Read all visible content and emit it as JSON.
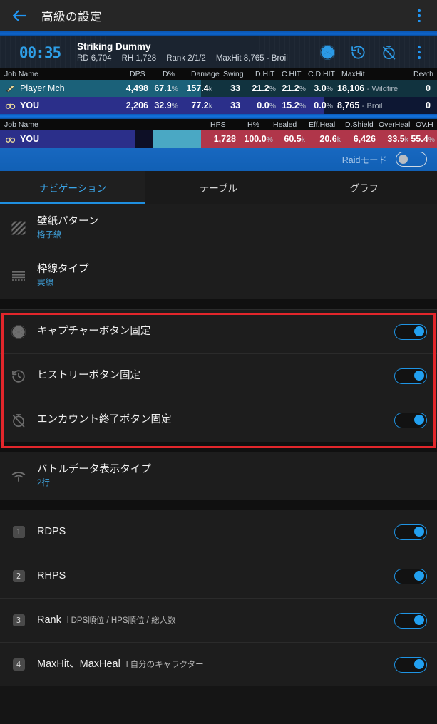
{
  "appbar": {
    "title": "高級の設定",
    "back_icon": "arrow-left-icon",
    "menu_icon": "kebab-menu-icon"
  },
  "meter": {
    "timer": "00:35",
    "encounter_title": "Striking Dummy",
    "stats": [
      {
        "label": "RD",
        "value": "6,704"
      },
      {
        "label": "RH",
        "value": "1,728"
      },
      {
        "label": "Rank",
        "value": "2/1/2"
      },
      {
        "label": "MaxHit",
        "value": "8,765 - Broil"
      }
    ],
    "stats_inline": [
      "RD 6,704",
      "RH 1,728",
      "Rank 2/1/2",
      "MaxHit 8,765 - Broil"
    ],
    "icons": [
      "capture-aperture-icon",
      "history-clock-icon",
      "end-encounter-icon",
      "kebab-menu-icon"
    ],
    "dps_headers": [
      "Job Name",
      "DPS",
      "D%",
      "Damage",
      "Swing",
      "D.HIT",
      "C.HIT",
      "C.D.HIT",
      "MaxHit",
      "Death"
    ],
    "dps_rows": [
      {
        "job_icon": "machinist-job-icon",
        "name": "Player Mch",
        "dps": "4,498",
        "dpct": "67.1",
        "damage": "157.4",
        "damage_unit": "k",
        "swing": "33",
        "dhit": "21.2",
        "chit": "21.2",
        "cdhit": "3.0",
        "maxhit": "18,106",
        "maxhit_src": "- Wildfire",
        "death": "0",
        "bar_pct": 46
      },
      {
        "job_icon": "astrologian-job-icon",
        "name": "YOU",
        "dps": "2,206",
        "dpct": "32.9",
        "damage": "77.2",
        "damage_unit": "k",
        "swing": "33",
        "dhit": "0.0",
        "chit": "15.2",
        "cdhit": "0.0",
        "maxhit": "8,765",
        "maxhit_src": "- Broil",
        "death": "0",
        "bar_pct": 74
      }
    ],
    "hps_headers": [
      "Job Name",
      "HPS",
      "H%",
      "Healed",
      "Eff.Heal",
      "D.Shield",
      "OverHeal",
      "OV.H"
    ],
    "hps_rows": [
      {
        "job_icon": "astrologian-job-icon",
        "name": "YOU",
        "hps": "1,728",
        "hpct": "100.0",
        "healed": "60.5",
        "healed_unit": "k",
        "effheal": "20.6",
        "effheal_unit": "k",
        "dshield": "6,426",
        "overheal": "33.5",
        "overheal_unit": "k",
        "ovh": "55.4",
        "bar_pct": 31,
        "bar2_pct": 26
      }
    ],
    "raid_mode_label": "Raidモード",
    "raid_mode_on": false
  },
  "tabs": [
    {
      "label": "ナビゲーション",
      "active": true
    },
    {
      "label": "テーブル",
      "active": false
    },
    {
      "label": "グラフ",
      "active": false
    }
  ],
  "settings": {
    "group1": [
      {
        "icon": "diagonal-stripes-icon",
        "title": "壁紙パターン",
        "subtitle": "格子縞",
        "type": "value"
      },
      {
        "icon": "border-lines-icon",
        "title": "枠線タイプ",
        "subtitle": "実線",
        "type": "value"
      }
    ],
    "group_highlighted": [
      {
        "icon": "capture-aperture-icon",
        "title": "キャプチャーボタン固定",
        "type": "toggle",
        "on": true
      },
      {
        "icon": "history-clock-icon",
        "title": "ヒストリーボタン固定",
        "type": "toggle",
        "on": true
      },
      {
        "icon": "end-encounter-icon",
        "title": "エンカウント終了ボタン固定",
        "type": "toggle",
        "on": true
      }
    ],
    "group2": [
      {
        "icon": "signal-rows-icon",
        "title": "バトルデータ表示タイプ",
        "subtitle": "2行",
        "type": "value"
      }
    ],
    "group3": [
      {
        "badge": "1",
        "title": "RDPS",
        "hint": "",
        "type": "toggle",
        "on": true
      },
      {
        "badge": "2",
        "title": "RHPS",
        "hint": "",
        "type": "toggle",
        "on": true
      },
      {
        "badge": "3",
        "title": "Rank",
        "hint": "l DPS順位 / HPS順位 / 総人数",
        "type": "toggle",
        "on": true
      },
      {
        "badge": "4",
        "title": "MaxHit、MaxHeal",
        "hint": "l 自分のキャラクター",
        "type": "toggle",
        "on": true
      }
    ]
  },
  "colors": {
    "accent_blue": "#2196f3",
    "highlight_red": "#e2262b",
    "toggle_on": "#22a0f0",
    "subtitle_blue": "#3f9fd8",
    "hps_bar_red": "#b0364a",
    "hps_bar_cyan": "#4aa8c4"
  }
}
